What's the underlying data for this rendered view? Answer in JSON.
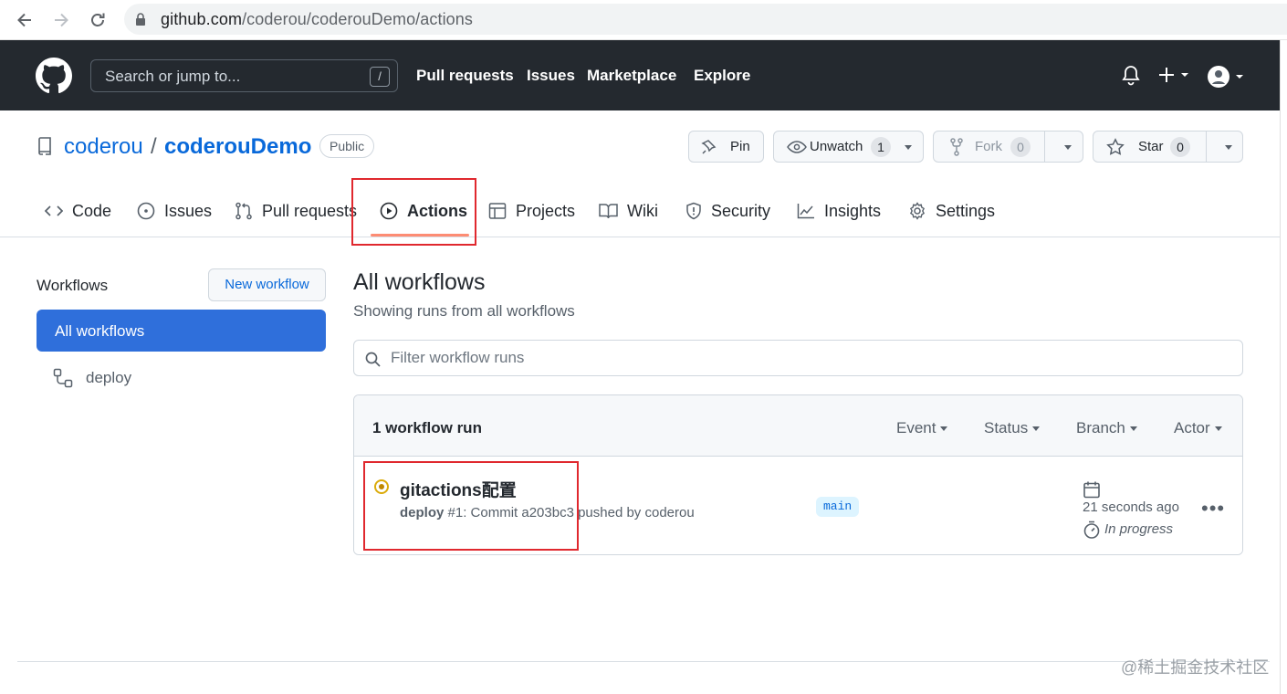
{
  "browser": {
    "url_host": "github.com",
    "url_path": "/coderou/coderouDemo/actions"
  },
  "header": {
    "search_placeholder": "Search or jump to...",
    "search_shortcut": "/",
    "nav": [
      "Pull requests",
      "Issues",
      "Marketplace",
      "Explore"
    ],
    "icons": [
      "bell-icon",
      "plus-icon",
      "avatar"
    ]
  },
  "repo": {
    "owner": "coderou",
    "separator": "/",
    "name": "coderouDemo",
    "visibility": "Public",
    "pin_label": "Pin",
    "watch_label": "Unwatch",
    "watch_count": "1",
    "fork_label": "Fork",
    "fork_count": "0",
    "star_label": "Star",
    "star_count": "0"
  },
  "tabs": [
    {
      "label": "Code",
      "icon": "code-icon"
    },
    {
      "label": "Issues",
      "icon": "issue-icon"
    },
    {
      "label": "Pull requests",
      "icon": "pull-request-icon"
    },
    {
      "label": "Actions",
      "icon": "play-icon",
      "active": true
    },
    {
      "label": "Projects",
      "icon": "table-icon"
    },
    {
      "label": "Wiki",
      "icon": "book-icon"
    },
    {
      "label": "Security",
      "icon": "shield-icon"
    },
    {
      "label": "Insights",
      "icon": "graph-icon"
    },
    {
      "label": "Settings",
      "icon": "gear-icon"
    }
  ],
  "sidebar": {
    "title": "Workflows",
    "new_workflow": "New workflow",
    "items": [
      {
        "label": "All workflows",
        "active": true
      },
      {
        "label": "deploy",
        "icon": "workflow-icon"
      }
    ]
  },
  "main": {
    "title": "All workflows",
    "subtitle": "Showing runs from all workflows",
    "filter_placeholder": "Filter workflow runs",
    "runs_count": "1 workflow run",
    "filters": [
      "Event",
      "Status",
      "Branch",
      "Actor"
    ],
    "runs": [
      {
        "title": "gitactions配置",
        "workflow": "deploy",
        "meta": "#1: Commit a203bc3 pushed by coderou",
        "branch": "main",
        "time": "21 seconds ago",
        "status": "In progress",
        "status_color": "#dbab0a"
      }
    ]
  },
  "watermark": "@稀土掘金技术社区",
  "colors": {
    "header_bg": "#24292f",
    "link": "#0969da",
    "active_sidebar": "#2f6fdb",
    "tab_underline": "#fd8c73",
    "annotation": "#e0282e"
  }
}
